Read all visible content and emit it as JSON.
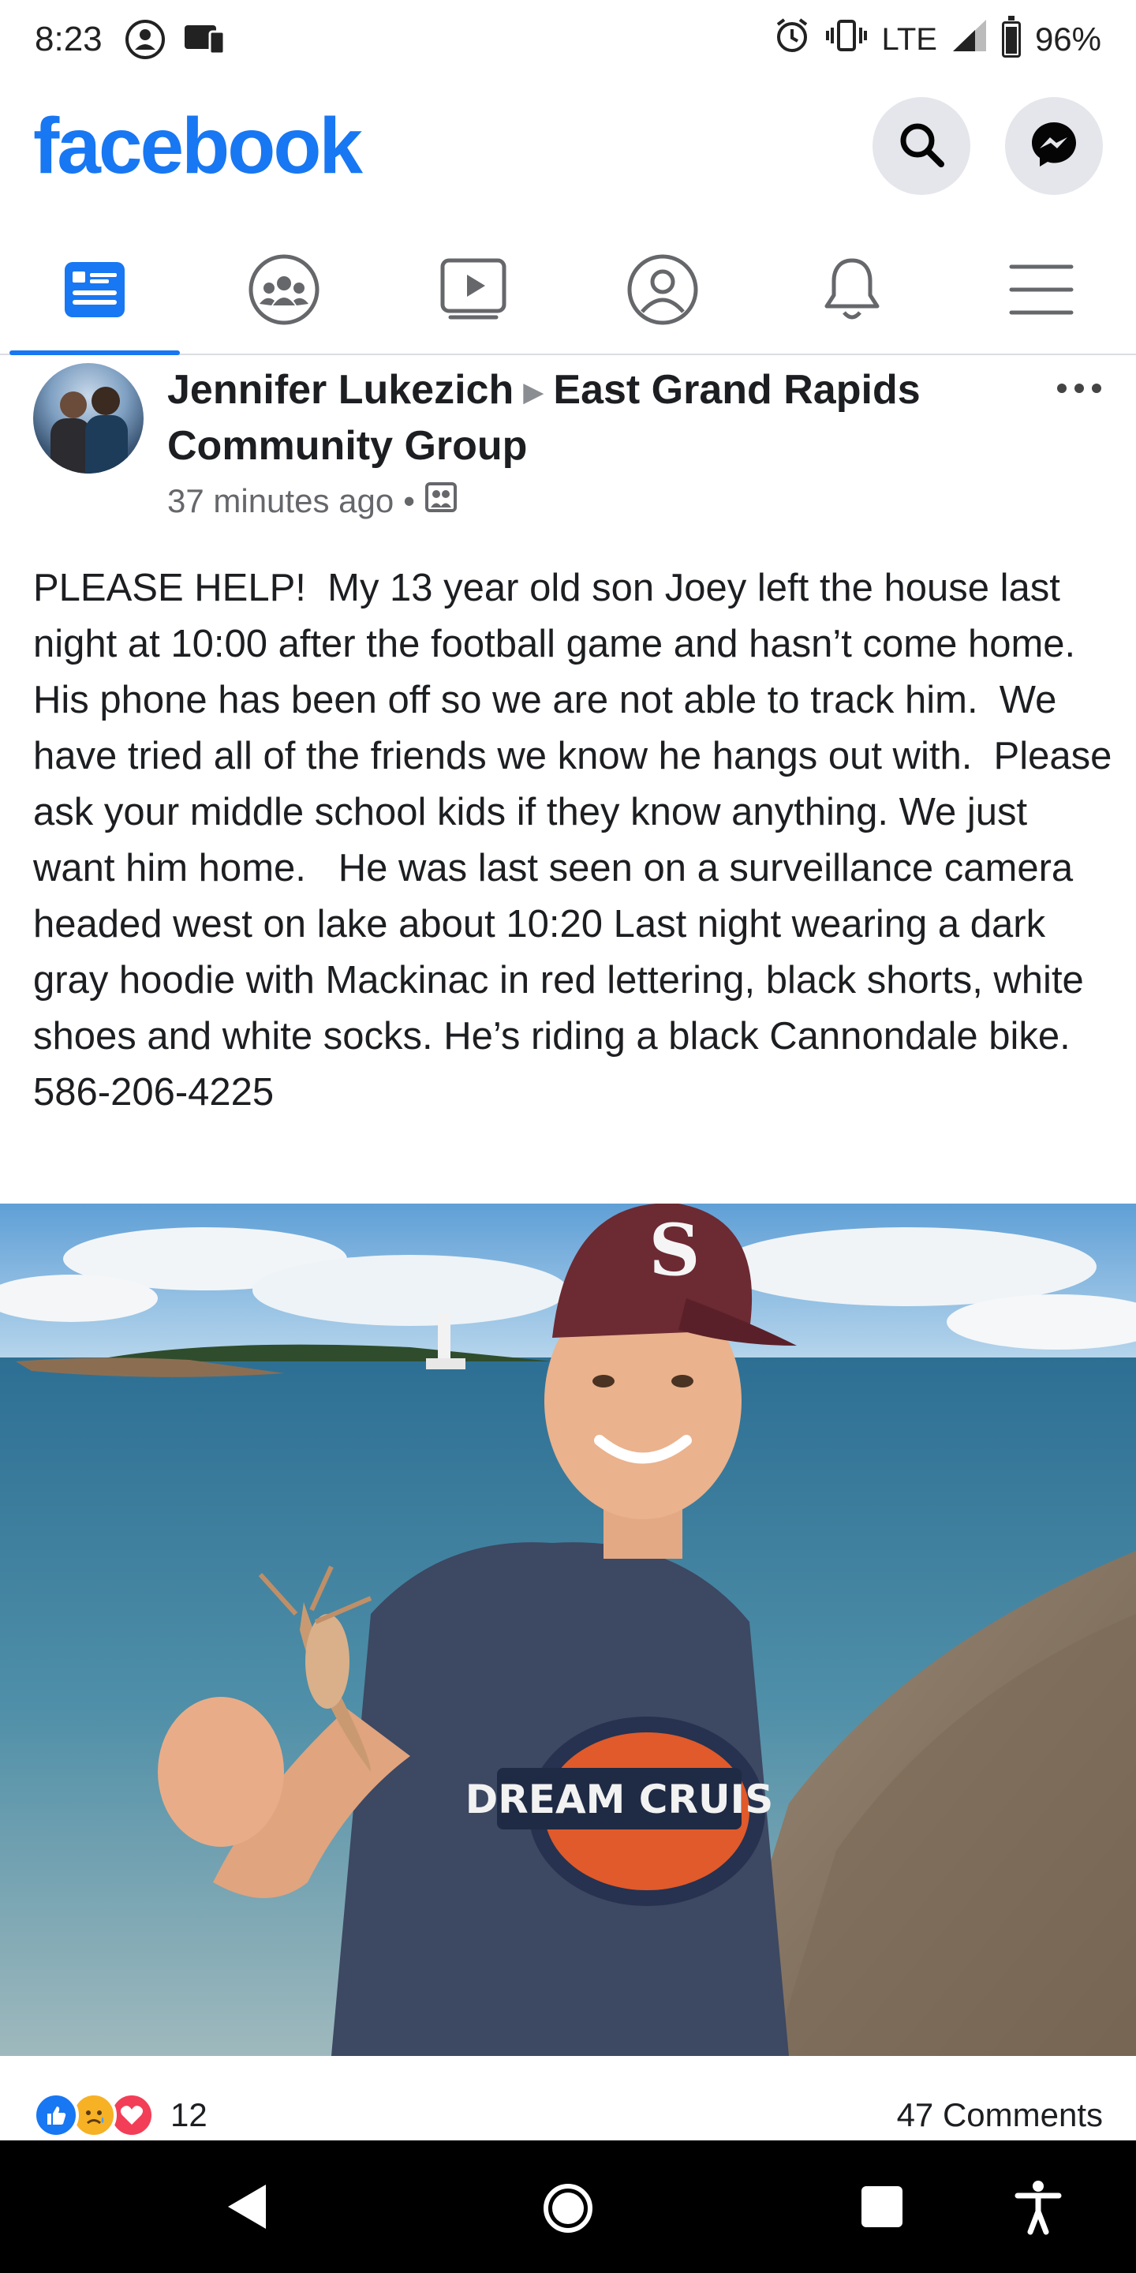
{
  "status_bar": {
    "time": "8:23",
    "network": "LTE",
    "battery": "96%"
  },
  "header": {
    "logo_text": "facebook",
    "brand_color": "#1877f2"
  },
  "nav_tabs": [
    {
      "name": "news-feed",
      "icon": "news-feed-icon",
      "active": true
    },
    {
      "name": "groups",
      "icon": "groups-icon",
      "active": false
    },
    {
      "name": "watch",
      "icon": "video-icon",
      "active": false
    },
    {
      "name": "profile",
      "icon": "profile-icon",
      "active": false
    },
    {
      "name": "notifications",
      "icon": "bell-icon",
      "active": false
    },
    {
      "name": "menu",
      "icon": "hamburger-menu-icon",
      "active": false
    }
  ],
  "post": {
    "author": "Jennifer Lukezich",
    "group": "East Grand Rapids Community Group",
    "time": "37 minutes ago",
    "separator": "•",
    "text": "PLEASE HELP!  My 13 year old son Joey left the house last night at 10:00 after the football game and hasn’t come home.  His phone has been off so we are not able to track him.  We have tried all of the friends we know he hangs out with.  Please ask your middle school kids if they know anything. We just want him home.   He was last seen on a surveillance camera headed west on lake about 10:20 Last night wearing a dark gray hoodie with Mackinac in red lettering, black shorts, white shoes and white socks. He’s riding a black Cannondale bike. 586-206-4225",
    "photo": {
      "cap_letter": "S",
      "shirt_text": "DREAM CRUIS"
    },
    "reaction_count": "12",
    "comments": "47 Comments"
  }
}
